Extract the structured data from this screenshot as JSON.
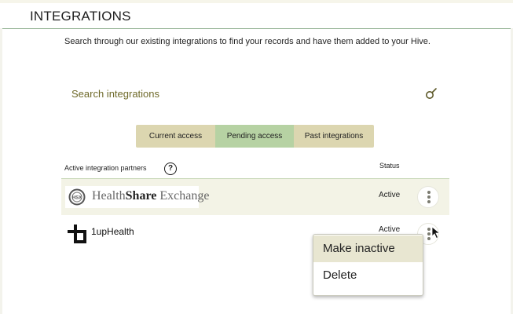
{
  "header": {
    "title": "INTEGRATIONS"
  },
  "intro": {
    "text": "Search through our existing integrations to find your records and have them added to your Hive."
  },
  "search": {
    "placeholder": "Search integrations",
    "icon": "search-icon"
  },
  "tabs": [
    {
      "label": "Current access",
      "selected": false
    },
    {
      "label": "Pending access",
      "selected": true
    },
    {
      "label": "Past integrations",
      "selected": false
    }
  ],
  "list": {
    "header_label": "Active integration partners",
    "help_glyph": "?",
    "status_header": "Status",
    "rows": [
      {
        "name_part1": "Health",
        "name_part2": "Share",
        "name_part3": " Exchange",
        "logo_text": "HSX",
        "status": "Active",
        "logo": "healthshare-exchange-logo"
      },
      {
        "name": "1upHealth",
        "status": "Active",
        "logo": "1uphealth-logo"
      }
    ]
  },
  "context_menu": {
    "items": [
      "Make inactive",
      "Delete"
    ]
  },
  "colors": {
    "accent_green": "#b6d2a3",
    "tab_tan": "#dcd6b0",
    "placeholder_olive": "#6f6a2a",
    "row_highlight": "#f3f3e6",
    "menu_highlight": "#e8e6d1"
  }
}
